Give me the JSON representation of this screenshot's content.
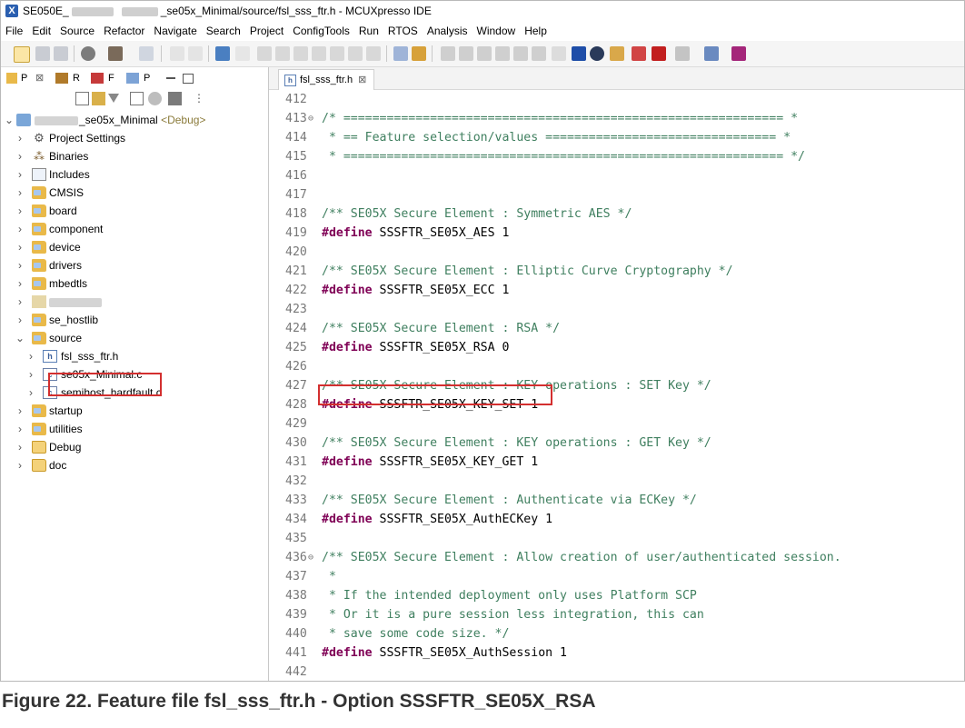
{
  "window": {
    "title_prefix": "SE050E_",
    "title_blur1": "xxxxxxxx",
    "title_blur2": "xxxxxxx",
    "title_suffix": "_se05x_Minimal/source/fsl_sss_ftr.h - MCUXpresso IDE"
  },
  "menu": [
    "File",
    "Edit",
    "Source",
    "Refactor",
    "Navigate",
    "Search",
    "Project",
    "ConfigTools",
    "Run",
    "RTOS",
    "Analysis",
    "Window",
    "Help"
  ],
  "view_tabs": {
    "p": "P",
    "close": "⊠",
    "r": "R",
    "f": "F",
    "p2": "P"
  },
  "tree": {
    "project_name": "_se05x_Minimal",
    "project_config": "<Debug>",
    "items": [
      {
        "label": "Project Settings"
      },
      {
        "label": "Binaries"
      },
      {
        "label": "Includes"
      },
      {
        "label": "CMSIS"
      },
      {
        "label": "board"
      },
      {
        "label": "component"
      },
      {
        "label": "device"
      },
      {
        "label": "drivers"
      },
      {
        "label": "mbedtls"
      },
      {
        "label": ""
      },
      {
        "label": "se_hostlib"
      },
      {
        "label": "source"
      },
      {
        "label": "fsl_sss_ftr.h"
      },
      {
        "label": "se05x_Minimal.c"
      },
      {
        "label": "semihost_hardfault.c"
      },
      {
        "label": "startup"
      },
      {
        "label": "utilities"
      },
      {
        "label": "Debug"
      },
      {
        "label": "doc"
      }
    ]
  },
  "editor": {
    "tab_label": "fsl_sss_ftr.h",
    "tab_close": "⊠",
    "lines": [
      {
        "n": "412",
        "fold": "",
        "parts": []
      },
      {
        "n": "413",
        "fold": "⊖",
        "parts": [
          {
            "c": "comment",
            "t": "/* ============================================================= *"
          }
        ]
      },
      {
        "n": "414",
        "fold": "",
        "parts": [
          {
            "c": "comment",
            "t": " * == Feature selection/values ================================ *"
          }
        ]
      },
      {
        "n": "415",
        "fold": "",
        "parts": [
          {
            "c": "comment",
            "t": " * ============================================================= */"
          }
        ]
      },
      {
        "n": "416",
        "fold": "",
        "parts": []
      },
      {
        "n": "417",
        "fold": "",
        "parts": []
      },
      {
        "n": "418",
        "fold": "",
        "parts": [
          {
            "c": "comment",
            "t": "/** SE05X Secure Element : Symmetric AES */"
          }
        ]
      },
      {
        "n": "419",
        "fold": "",
        "parts": [
          {
            "c": "kw",
            "t": "#define"
          },
          {
            "c": "ident",
            "t": " SSSFTR_SE05X_AES 1"
          }
        ]
      },
      {
        "n": "420",
        "fold": "",
        "parts": []
      },
      {
        "n": "421",
        "fold": "",
        "parts": [
          {
            "c": "comment",
            "t": "/** SE05X Secure Element : Elliptic Curve Cryptography */"
          }
        ]
      },
      {
        "n": "422",
        "fold": "",
        "parts": [
          {
            "c": "kw",
            "t": "#define"
          },
          {
            "c": "ident",
            "t": " SSSFTR_SE05X_ECC 1"
          }
        ]
      },
      {
        "n": "423",
        "fold": "",
        "parts": []
      },
      {
        "n": "424",
        "fold": "",
        "parts": [
          {
            "c": "comment",
            "t": "/** SE05X Secure Element : RSA */"
          }
        ]
      },
      {
        "n": "425",
        "fold": "",
        "parts": [
          {
            "c": "kw",
            "t": "#define"
          },
          {
            "c": "ident",
            "t": " SSSFTR_SE05X_RSA 0"
          }
        ]
      },
      {
        "n": "426",
        "fold": "",
        "parts": []
      },
      {
        "n": "427",
        "fold": "",
        "parts": [
          {
            "c": "comment",
            "t": "/** SE05X Secure Element : KEY operations : SET Key */"
          }
        ]
      },
      {
        "n": "428",
        "fold": "",
        "parts": [
          {
            "c": "kw",
            "t": "#define"
          },
          {
            "c": "ident",
            "t": " SSSFTR_SE05X_KEY_SET 1"
          }
        ]
      },
      {
        "n": "429",
        "fold": "",
        "parts": []
      },
      {
        "n": "430",
        "fold": "",
        "parts": [
          {
            "c": "comment",
            "t": "/** SE05X Secure Element : KEY operations : GET Key */"
          }
        ]
      },
      {
        "n": "431",
        "fold": "",
        "parts": [
          {
            "c": "kw",
            "t": "#define"
          },
          {
            "c": "ident",
            "t": " SSSFTR_SE05X_KEY_GET 1"
          }
        ]
      },
      {
        "n": "432",
        "fold": "",
        "parts": []
      },
      {
        "n": "433",
        "fold": "",
        "parts": [
          {
            "c": "comment",
            "t": "/** SE05X Secure Element : Authenticate via ECKey */"
          }
        ]
      },
      {
        "n": "434",
        "fold": "",
        "parts": [
          {
            "c": "kw",
            "t": "#define"
          },
          {
            "c": "ident",
            "t": " SSSFTR_SE05X_AuthECKey 1"
          }
        ]
      },
      {
        "n": "435",
        "fold": "",
        "parts": []
      },
      {
        "n": "436",
        "fold": "⊖",
        "parts": [
          {
            "c": "comment",
            "t": "/** SE05X Secure Element : Allow creation of user/authenticated session."
          }
        ]
      },
      {
        "n": "437",
        "fold": "",
        "parts": [
          {
            "c": "comment",
            "t": " *"
          }
        ]
      },
      {
        "n": "438",
        "fold": "",
        "parts": [
          {
            "c": "comment",
            "t": " * If the intended deployment only uses Platform SCP"
          }
        ]
      },
      {
        "n": "439",
        "fold": "",
        "parts": [
          {
            "c": "comment",
            "t": " * Or it is a pure session less integration, this can"
          }
        ]
      },
      {
        "n": "440",
        "fold": "",
        "parts": [
          {
            "c": "comment",
            "t": " * save some code size. */"
          }
        ]
      },
      {
        "n": "441",
        "fold": "",
        "parts": [
          {
            "c": "kw",
            "t": "#define"
          },
          {
            "c": "ident",
            "t": " SSSFTR_SE05X_AuthSession 1"
          }
        ]
      },
      {
        "n": "442",
        "fold": "",
        "parts": []
      }
    ]
  },
  "caption": {
    "text": "Figure 22.   Feature file fsl_sss_ftr.h - Option SSSFTR_SE05X_RSA"
  },
  "colors": {
    "comment": "#3f7f5f",
    "keyword": "#7f0055",
    "highlight": "#d32f2f"
  }
}
